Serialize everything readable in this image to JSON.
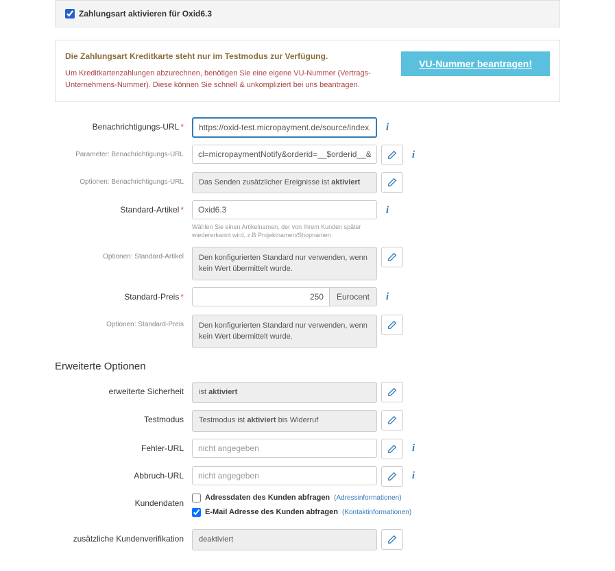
{
  "activation": {
    "label": "Zahlungsart aktivieren für Oxid6.3",
    "checked": true
  },
  "infoBox": {
    "title": "Die Zahlungsart Kreditkarte steht nur im Testmodus zur Verfügung.",
    "description": "Um Kreditkartenzahlungen abzurechnen, benötigen Sie eine eigene VU-Nummer (Vertrags-Unternehmens-Nummer). Diese können Sie schnell & unkompliziert bei uns beantragen.",
    "buttonLabel": "VU-Nummer beantragen!"
  },
  "fields": {
    "notifyUrl": {
      "label": "Benachrichtigungs-URL",
      "value": "https://oxid-test.micropayment.de/source/index.php"
    },
    "notifyParams": {
      "label": "Parameter: Benachrichtigungs-URL",
      "value": "cl=micropaymentNotify&orderid=__$orderid__&amou"
    },
    "notifyOptions": {
      "label": "Optionen: Benachrichtigungs-URL",
      "prefix": "Das Senden zusätzlicher Ereignisse ist ",
      "bold": "aktiviert"
    },
    "standardArticle": {
      "label": "Standard-Artikel",
      "value": "Oxid6.3",
      "help": "Wählen Sie einen Artikelnamen, der von Ihrem Kunden später wiedererkannt wird, z.B Projektnamen/Shopnamen"
    },
    "standardArticleOptions": {
      "label": "Optionen: Standard-Artikel",
      "value": "Den konfigurierten Standard nur verwenden, wenn kein Wert übermittelt wurde."
    },
    "standardPrice": {
      "label": "Standard-Preis",
      "value": "250",
      "unit": "Eurocent"
    },
    "standardPriceOptions": {
      "label": "Optionen: Standard-Preis",
      "value": "Den konfigurierten Standard nur verwenden, wenn kein Wert übermittelt wurde."
    }
  },
  "advanced": {
    "title": "Erweiterte Optionen",
    "security": {
      "label": "erweiterte Sicherheit",
      "prefix": "ist ",
      "bold": "aktiviert"
    },
    "testmode": {
      "label": "Testmodus",
      "prefix": "Testmodus ist ",
      "bold": "aktiviert",
      "suffix": " bis Widerruf"
    },
    "errorUrl": {
      "label": "Fehler-URL",
      "placeholder": "nicht angegeben"
    },
    "cancelUrl": {
      "label": "Abbruch-URL",
      "placeholder": "nicht angegeben"
    },
    "customerData": {
      "label": "Kundendaten",
      "address": {
        "checked": false,
        "label": "Adressdaten des Kunden abfragen",
        "link": "(Adressinformationen)"
      },
      "email": {
        "checked": true,
        "label": "E-Mail Adresse des Kunden abfragen",
        "link": "(Kontaktinformationen)"
      }
    },
    "verification": {
      "label": "zusätzliche Kundenverifikation",
      "value": "deaktiviert"
    }
  }
}
